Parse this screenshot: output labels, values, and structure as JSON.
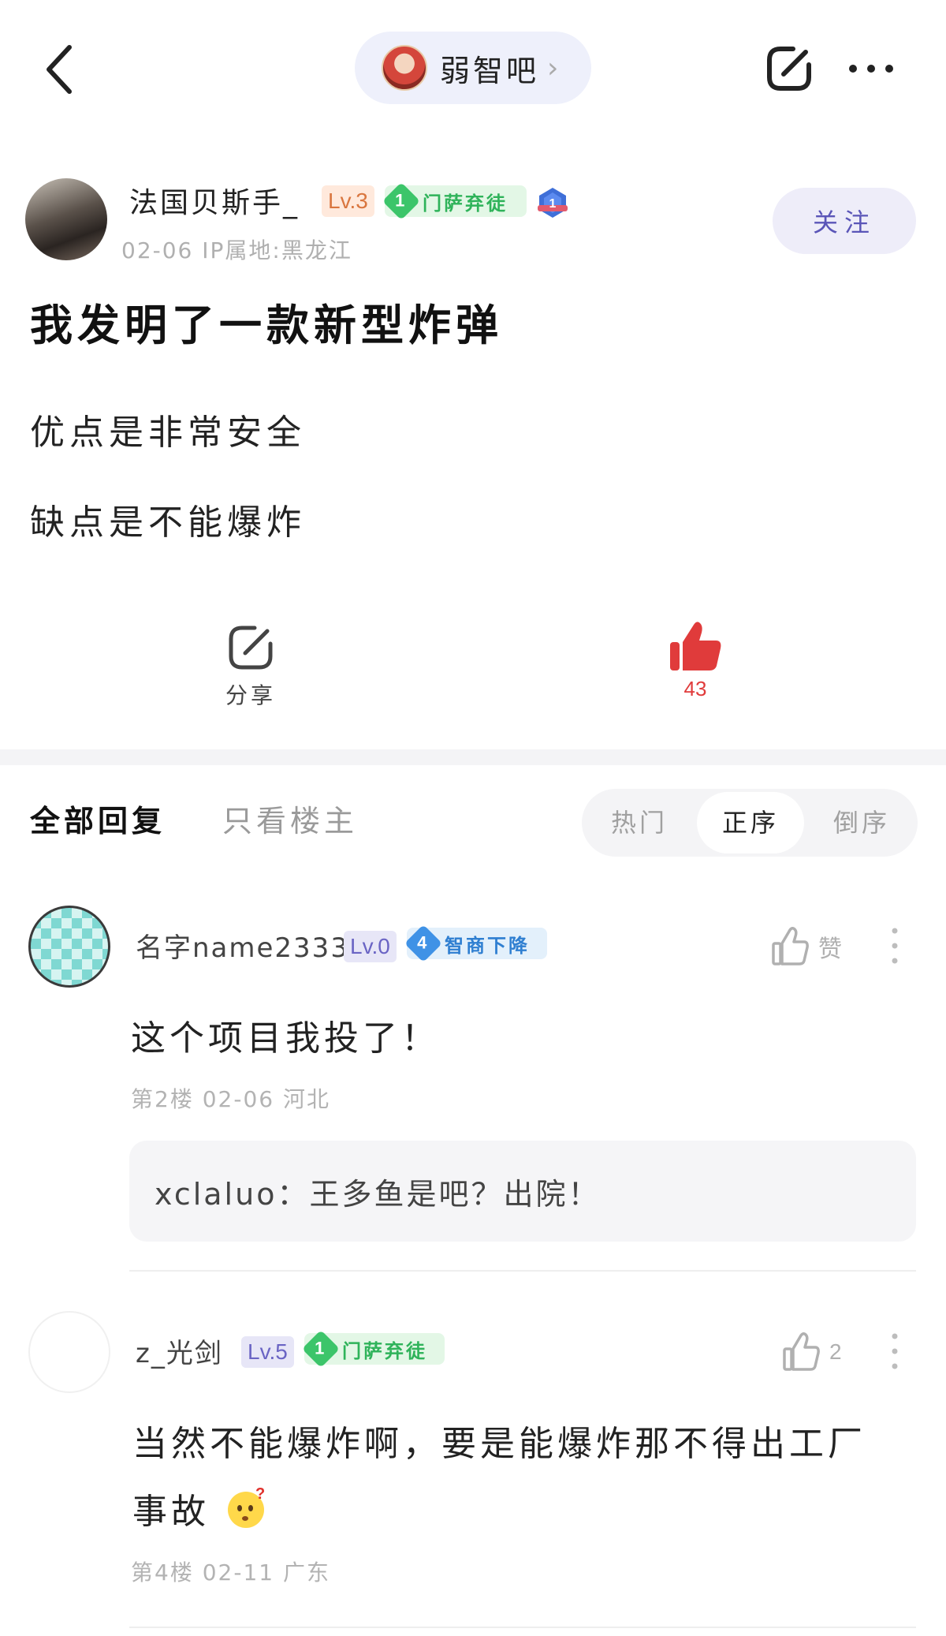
{
  "forum": {
    "name": "弱智吧",
    "chevron": "›"
  },
  "post": {
    "author": "法国贝斯手_",
    "level": "Lv.3",
    "badge_level": "1",
    "badge_title": "门萨弃徒",
    "meta": "02-06   IP属地:黑龙江",
    "follow_label": "关注",
    "title": "我发明了一款新型炸弹",
    "lines": [
      "优点是非常安全",
      "缺点是不能爆炸"
    ],
    "share_label": "分享",
    "like_count": "43"
  },
  "tabs": {
    "all": "全部回复",
    "op_only": "只看楼主"
  },
  "sort": {
    "hot": "热门",
    "asc": "正序",
    "desc": "倒序",
    "selected": "正序"
  },
  "replies": [
    {
      "author": "名字name2333",
      "level": "Lv.0",
      "badge_level": "4",
      "badge_title": "智商下降",
      "like_label": "赞",
      "text": "这个项目我投了！",
      "meta": "第2楼  02-06  河北",
      "sub_reply": "xclaluo：王多鱼是吧？出院！"
    },
    {
      "author": "z_光剑",
      "level": "Lv.5",
      "badge_level": "1",
      "badge_title": "门萨弃徒",
      "like_count": "2",
      "text_line_1": "当然不能爆炸啊，要是能爆炸那不得出工厂",
      "text_line_2": "事故",
      "meta": "第4楼  02-11  广东"
    }
  ],
  "icons": {
    "back": "chevron-left-icon",
    "share": "share-icon",
    "more": "more-horizontal-icon",
    "like": "thumbs-up-icon",
    "emoji": "thinking-face-icon"
  },
  "colors": {
    "like_active": "#e03b3b",
    "follow_text": "#5a55b8",
    "badge_green": "#3cc56a",
    "badge_blue": "#3f92e6"
  }
}
